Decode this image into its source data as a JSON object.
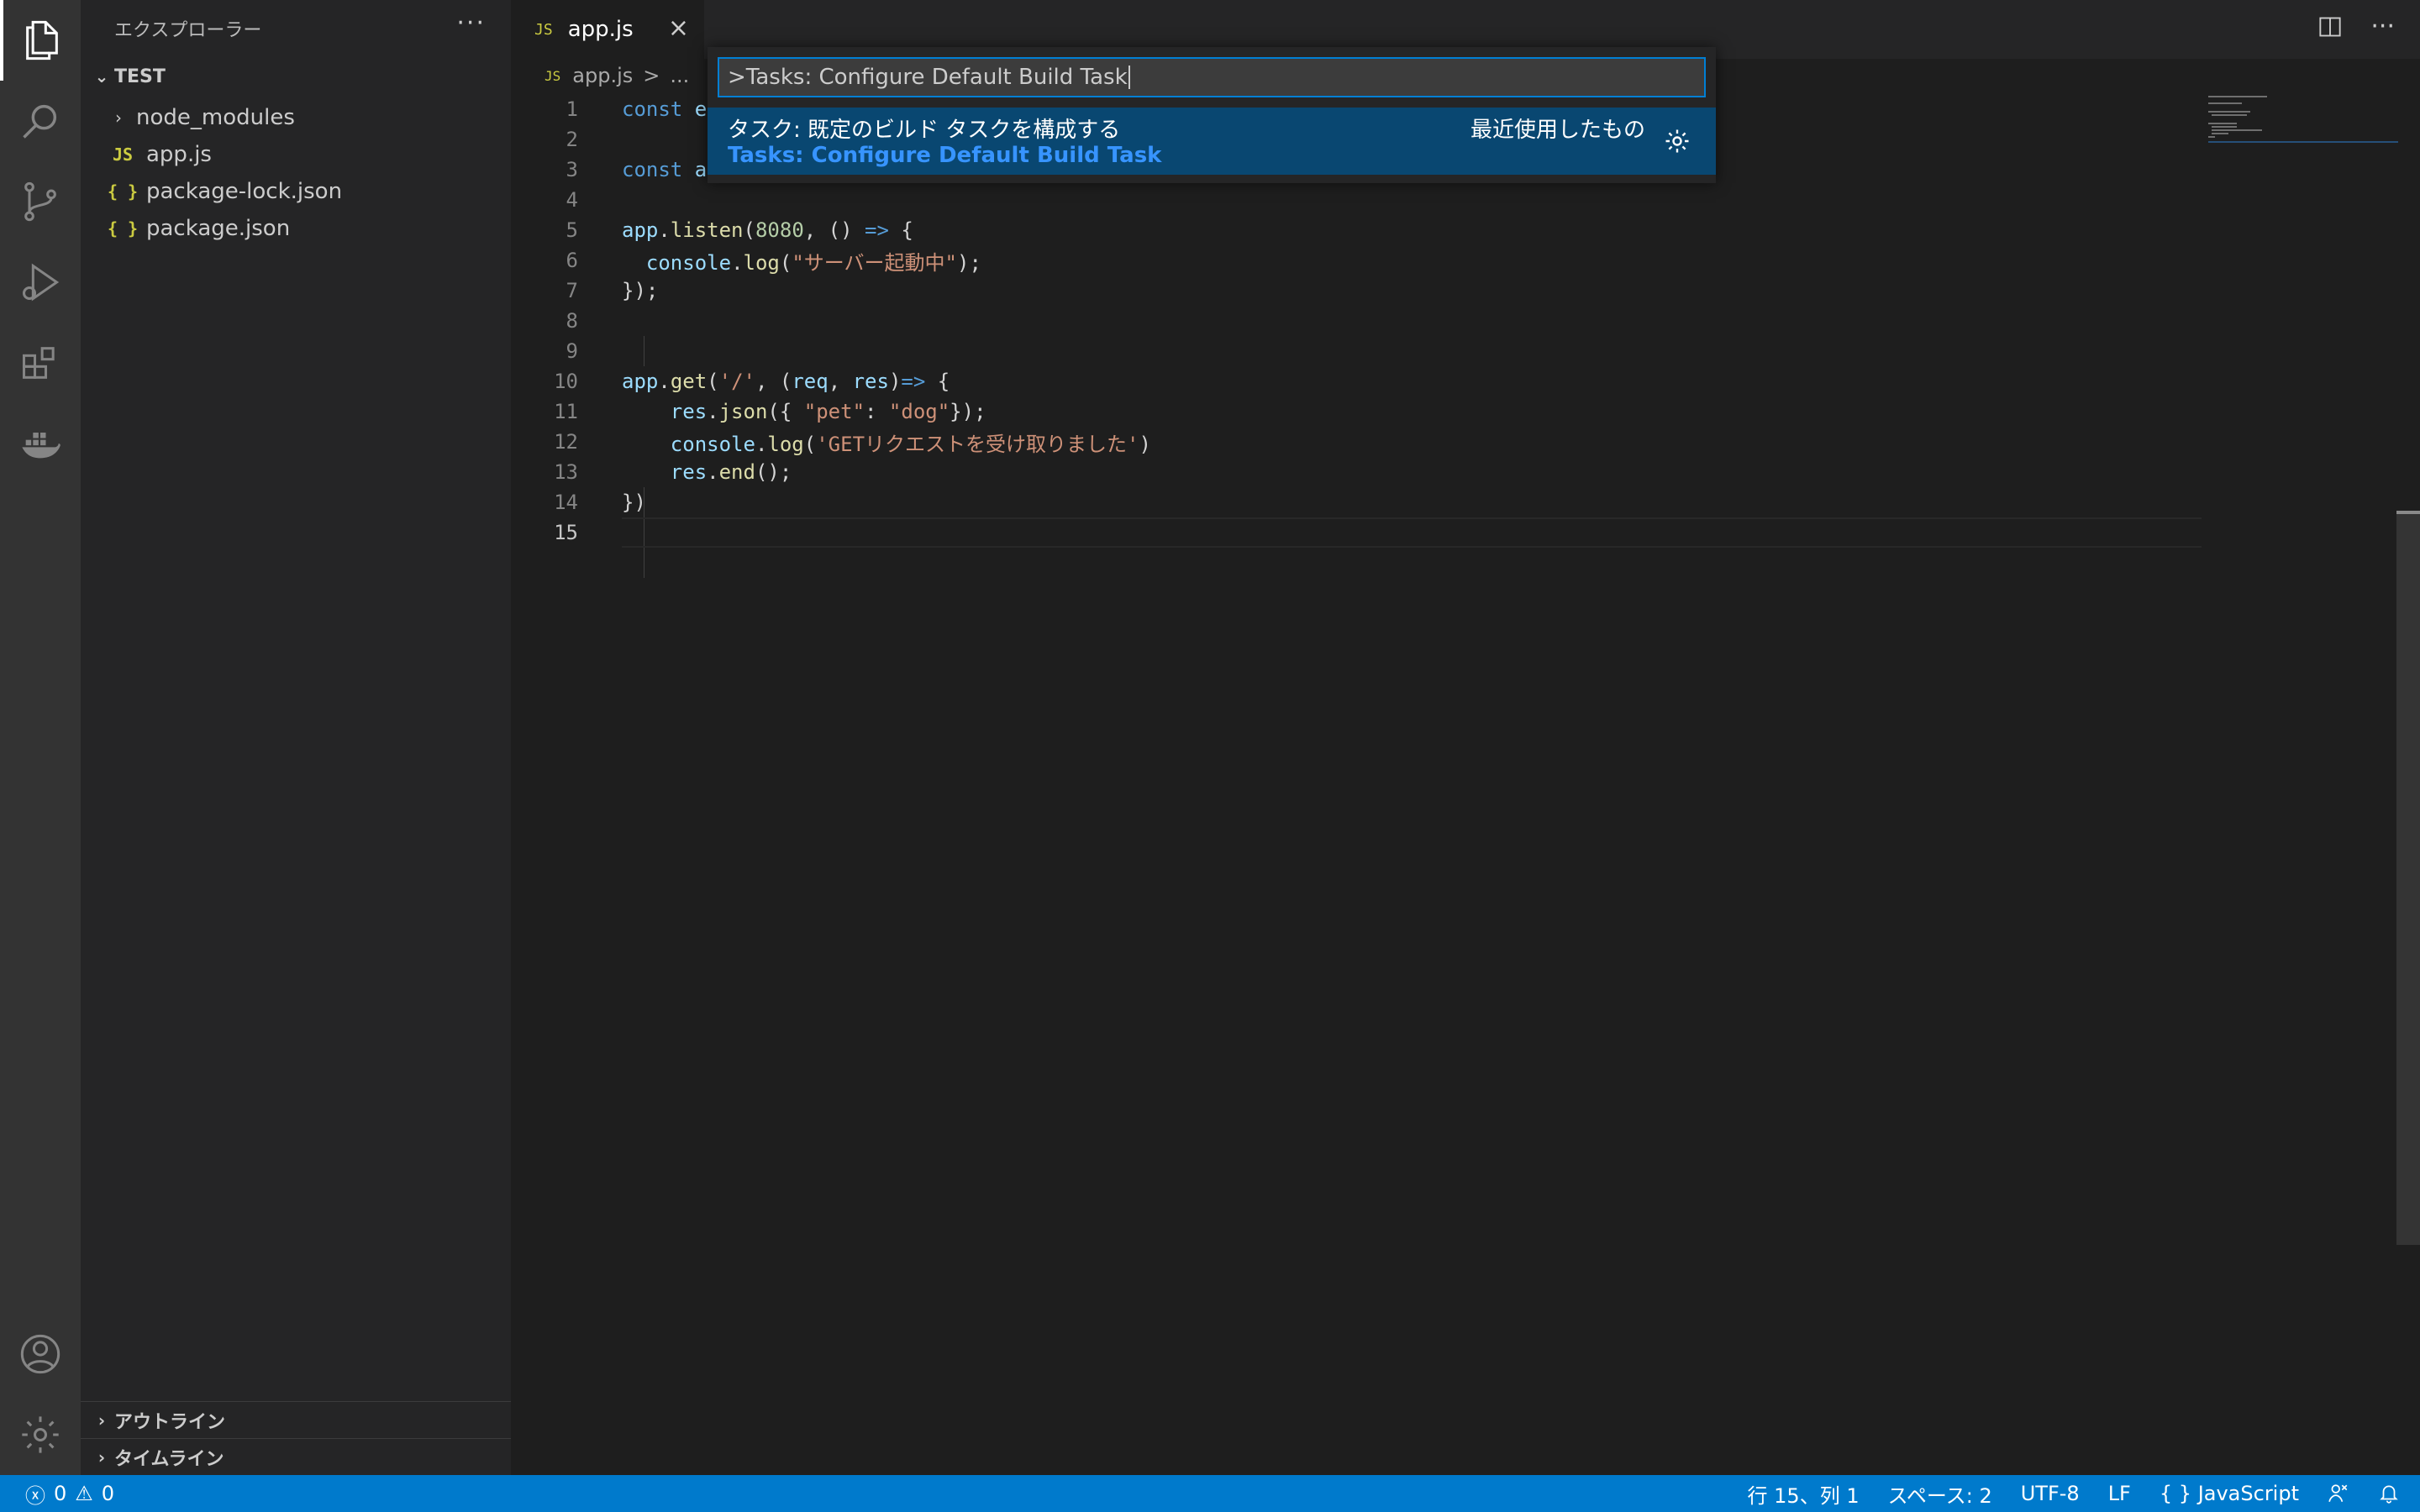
{
  "sidebar": {
    "title": "エクスプローラー",
    "more": "···",
    "folder": "TEST",
    "items": [
      {
        "label": "node_modules",
        "type": "folder"
      },
      {
        "label": "app.js",
        "type": "js"
      },
      {
        "label": "package-lock.json",
        "type": "json"
      },
      {
        "label": "package.json",
        "type": "json"
      }
    ],
    "file_badges": {
      "js": "JS",
      "json": "{ }"
    },
    "outline": "アウトライン",
    "timeline": "タイムライン"
  },
  "tabs": [
    {
      "badge": "JS",
      "label": "app.js",
      "active": true
    }
  ],
  "breadcrumb": {
    "badge": "JS",
    "file": "app.js",
    "separator": ">",
    "rest": "..."
  },
  "editor": {
    "line_numbers": [
      "1",
      "2",
      "3",
      "4",
      "5",
      "6",
      "7",
      "8",
      "9",
      "10",
      "11",
      "12",
      "13",
      "14",
      "15"
    ],
    "current_line": "15"
  },
  "quick_pick": {
    "input_value": ">Tasks: Configure Default Build Task",
    "item_label": "タスク: 既定のビルド タスクを構成する",
    "item_detail": "Tasks: Configure Default Build Task",
    "item_badge": "最近使用したもの"
  },
  "statusbar": {
    "errors": "0",
    "warnings": "0",
    "position": "行 15、列 1",
    "spaces": "スペース: 2",
    "encoding": "UTF-8",
    "eol": "LF",
    "language_icon": "{ }",
    "language": "JavaScript"
  },
  "colors": {
    "accent": "#007acc",
    "selection": "#094771",
    "focus_border": "#007fd4"
  },
  "icons": {
    "activity": [
      "files-icon",
      "search-icon",
      "source-control-icon",
      "run-debug-icon",
      "extensions-icon",
      "docker-icon",
      "account-icon",
      "settings-gear-icon"
    ]
  }
}
